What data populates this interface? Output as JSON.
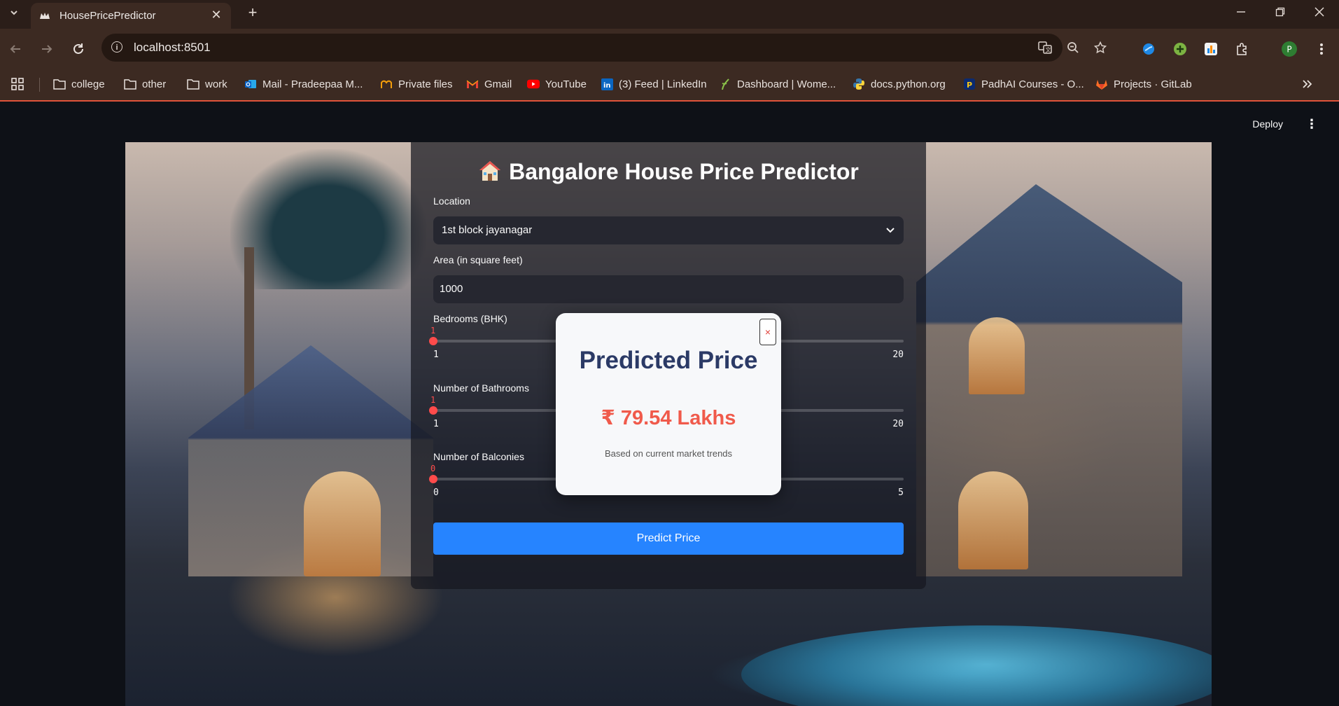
{
  "browser": {
    "tab_title": "HousePricePredictor",
    "url": "localhost:8501",
    "profile_initial": "P",
    "bookmarks": [
      {
        "label": "college",
        "icon": "folder-icon"
      },
      {
        "label": "other",
        "icon": "folder-icon"
      },
      {
        "label": "work",
        "icon": "folder-icon"
      },
      {
        "label": "Mail - Pradeepaa M...",
        "icon": "outlook-icon"
      },
      {
        "label": "Private files",
        "icon": "nextcloud-icon"
      },
      {
        "label": "Gmail",
        "icon": "gmail-icon"
      },
      {
        "label": "YouTube",
        "icon": "youtube-icon"
      },
      {
        "label": "(3) Feed | LinkedIn",
        "icon": "linkedin-icon"
      },
      {
        "label": "Dashboard | Wome...",
        "icon": "dashboard-icon"
      },
      {
        "label": "docs.python.org",
        "icon": "python-icon"
      },
      {
        "label": "PadhAI Courses - O...",
        "icon": "padhai-icon"
      },
      {
        "label": "Projects · GitLab",
        "icon": "gitlab-icon"
      }
    ]
  },
  "app": {
    "deploy_label": "Deploy",
    "title": "Bangalore House Price Predictor",
    "location": {
      "label": "Location",
      "value": "1st block jayanagar"
    },
    "area": {
      "label": "Area (in square feet)",
      "value": "1000"
    },
    "bedrooms": {
      "label": "Bedrooms (BHK)",
      "value": "1",
      "min": "1",
      "max": "20"
    },
    "bathrooms": {
      "label": "Number of Bathrooms",
      "value": "1",
      "min": "1",
      "max": "20"
    },
    "balconies": {
      "label": "Number of Balconies",
      "value": "0",
      "min": "0",
      "max": "5"
    },
    "predict_label": "Predict Price"
  },
  "modal": {
    "close_label": "×",
    "title": "Predicted Price",
    "price": "₹ 79.54 Lakhs",
    "note": "Based on current market trends"
  },
  "colors": {
    "accent": "#ff4b4b",
    "button": "#2684ff",
    "price": "#f05a4b",
    "modal_title": "#2b3a66"
  }
}
